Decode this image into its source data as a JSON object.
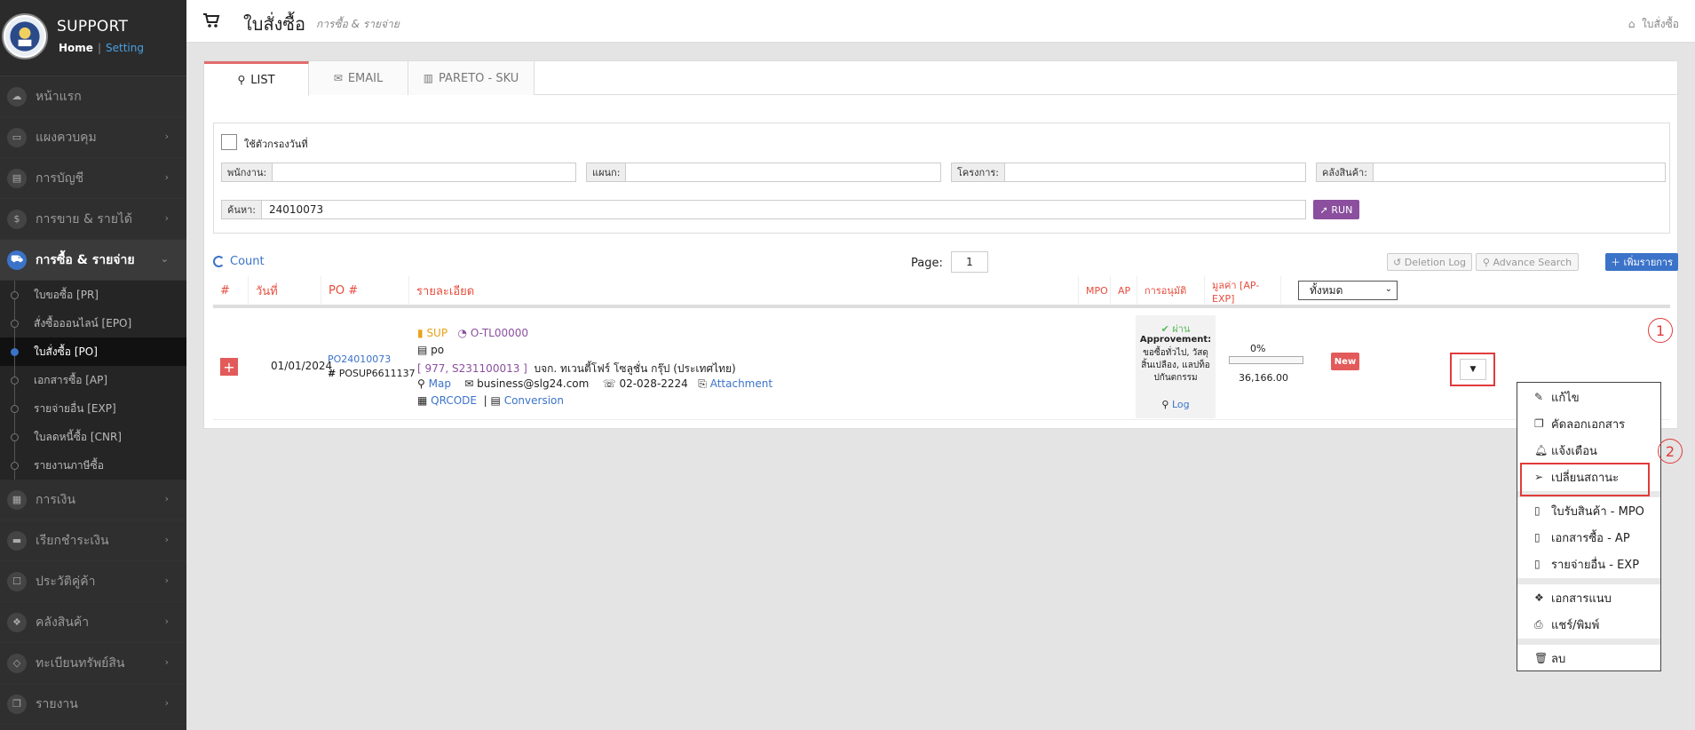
{
  "brand": {
    "title": "SUPPORT",
    "home": "Home",
    "sep": "|",
    "setting": "Setting"
  },
  "sidebar": {
    "items": [
      {
        "label": "หน้าแรก",
        "icon": "cloud-icon"
      },
      {
        "label": "แผงควบคุม",
        "icon": "monitor-icon"
      },
      {
        "label": "การบัญชี",
        "icon": "book-icon"
      },
      {
        "label": "การขาย & รายได้",
        "icon": "dollar-icon"
      },
      {
        "label": "การซื้อ & รายจ่าย",
        "icon": "cart-icon"
      },
      {
        "label": "การเงิน",
        "icon": "calendar-icon"
      },
      {
        "label": "เรียกชำระเงิน",
        "icon": "credit-card-icon"
      },
      {
        "label": "ประวัติคู่ค้า",
        "icon": "contact-icon"
      },
      {
        "label": "คลังสินค้า",
        "icon": "cubes-icon"
      },
      {
        "label": "ทะเบียนทรัพย์สิน",
        "icon": "diamond-icon"
      },
      {
        "label": "รายงาน",
        "icon": "copy-icon"
      }
    ],
    "submenu": [
      "ใบขอซื้อ [PR]",
      "สั่งซื้อออนไลน์ [EPO]",
      "ใบสั่งซื้อ [PO]",
      "เอกสารซื้อ [AP]",
      "รายจ่ายอื่น [EXP]",
      "ใบลดหนี้ซื้อ [CNR]",
      "รายงานภาษีซื้อ"
    ]
  },
  "header": {
    "title": "ใบสั่งซื้อ",
    "subtitle": "การซื้อ & รายจ่าย",
    "breadcrumb": "ใบสั่งซื้อ"
  },
  "tabs": [
    {
      "label": "LIST",
      "icon": "search-icon"
    },
    {
      "label": "EMAIL",
      "icon": "envelope-icon"
    },
    {
      "label": "PARETO - SKU",
      "icon": "bar-chart-icon"
    }
  ],
  "filter": {
    "date_filter_label": "ใช้ตัวกรองวันที่",
    "employee_label": "พนักงาน:",
    "employee_value": "",
    "department_label": "แผนก:",
    "department_value": "",
    "project_label": "โครงการ:",
    "project_value": "",
    "warehouse_label": "คลังสินค้า:",
    "warehouse_value": "",
    "search_label": "ค้นหา:",
    "search_value": "24010073",
    "run_label": "RUN"
  },
  "toolbar": {
    "count": "Count",
    "page_label": "Page:",
    "page_value": "1",
    "deletion_log": "Deletion Log",
    "advance_search": "Advance Search",
    "add": "เพิ่มรายการ"
  },
  "table": {
    "headers": {
      "num": "#",
      "date": "วันที่",
      "po": "PO #",
      "detail": "รายละเอียด",
      "mpo": "MPO",
      "ap": "AP",
      "approve": "การอนุมัติ",
      "value": "มูลค่า [AP-EXP]"
    },
    "status_filter": "ทั้งหมด",
    "row": {
      "date": "01/01/2024",
      "po": "PO24010073",
      "ref": "POSUP6611137",
      "sup": "SUP",
      "code": "O-TL00000",
      "doc": "po",
      "vendor_code": "[ 977, S231100013 ]",
      "vendor": "บจก. ทเวนตี้โฟร์ โซลูชั่น กรุ๊ป (ประเทศไทย)",
      "map": "Map",
      "email": "business@slg24.com",
      "phone": "02-028-2224",
      "attachment": "Attachment",
      "qrcode": "QRCODE",
      "sep": "|",
      "conversion": "Conversion",
      "approve_status": "ผ่าน",
      "approvement": "Approvement:",
      "approve_note": "ขอซื้อทั่วไป, วัสดุสิ้นเปลือง, แลปท็อปกันตกรรม",
      "log": "Log",
      "percent": "0%",
      "progress": 0,
      "amount": "36,166.00",
      "status": "New"
    }
  },
  "dropdown": {
    "items": [
      {
        "label": "แก้ไข",
        "icon": "edit-icon"
      },
      {
        "label": "คัดลอกเอกสาร",
        "icon": "copy-doc-icon"
      },
      {
        "label": "แจ้งเตือน",
        "icon": "bell-icon"
      },
      {
        "label": "เปลี่ยนสถานะ",
        "icon": "send-icon"
      },
      {
        "label": "ใบรับสินค้า - MPO",
        "icon": "file-icon"
      },
      {
        "label": "เอกสารซื้อ - AP",
        "icon": "file-icon"
      },
      {
        "label": "รายจ่ายอื่น - EXP",
        "icon": "file-icon"
      },
      {
        "label": "เอกสารแนบ",
        "icon": "dropbox-icon"
      },
      {
        "label": "แชร์/พิมพ์",
        "icon": "print-icon"
      },
      {
        "label": "ลบ",
        "icon": "trash-icon"
      }
    ]
  },
  "annotations": {
    "one": "1",
    "two": "2"
  },
  "colors": {
    "accent": "#3b73c9",
    "danger": "#e35a5a",
    "purple": "#8b4f9e",
    "header_red": "#e74c3c",
    "sidebar": "#2f2f2f"
  }
}
